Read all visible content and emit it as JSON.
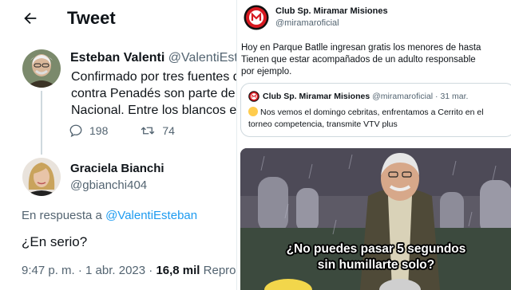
{
  "tweet_panel": {
    "header_title": "Tweet",
    "original": {
      "name": "Esteban Valenti",
      "handle": "@ValentiEste",
      "lines": [
        "Confirmado por tres fuentes d",
        "contra Penadés son parte de u",
        "Nacional. Entre los blancos es"
      ],
      "reply_count": "198",
      "retweet_count": "74"
    },
    "reply": {
      "name": "Graciela Bianchi",
      "handle": "@gbianchi404",
      "reply_prefix": "En respuesta a",
      "reply_to": "@ValentiEsteban",
      "text": "¿En serio?",
      "meta_time": "9:47 p. m. · 1 abr. 2023 ·",
      "meta_views": "16,8 mil",
      "meta_suffix": "Reprod"
    }
  },
  "club_panel": {
    "name": "Club Sp. Miramar Misiones",
    "handle": "@miramaroficial",
    "lines": [
      "Hoy en Parque Batlle ingresan gratis los menores de hasta",
      "Tienen que estar acompañados de un adulto responsable",
      "por ejemplo."
    ],
    "quote": {
      "name": "Club Sp. Miramar Misiones",
      "handle_date": "@miramaroficial · 31 mar.",
      "line1": "Nos vemos el domingo cebritas, enfrentamos a Cerrito en el",
      "line2": "torneo competencia, transmite VTV plus"
    },
    "meme": {
      "line1": "¿No puedes pasar 5 segundos",
      "line2": "sin humillarte solo?"
    }
  },
  "colors": {
    "link": "#1d9bf0",
    "secondary_text": "#536471",
    "club_red": "#d71920"
  }
}
